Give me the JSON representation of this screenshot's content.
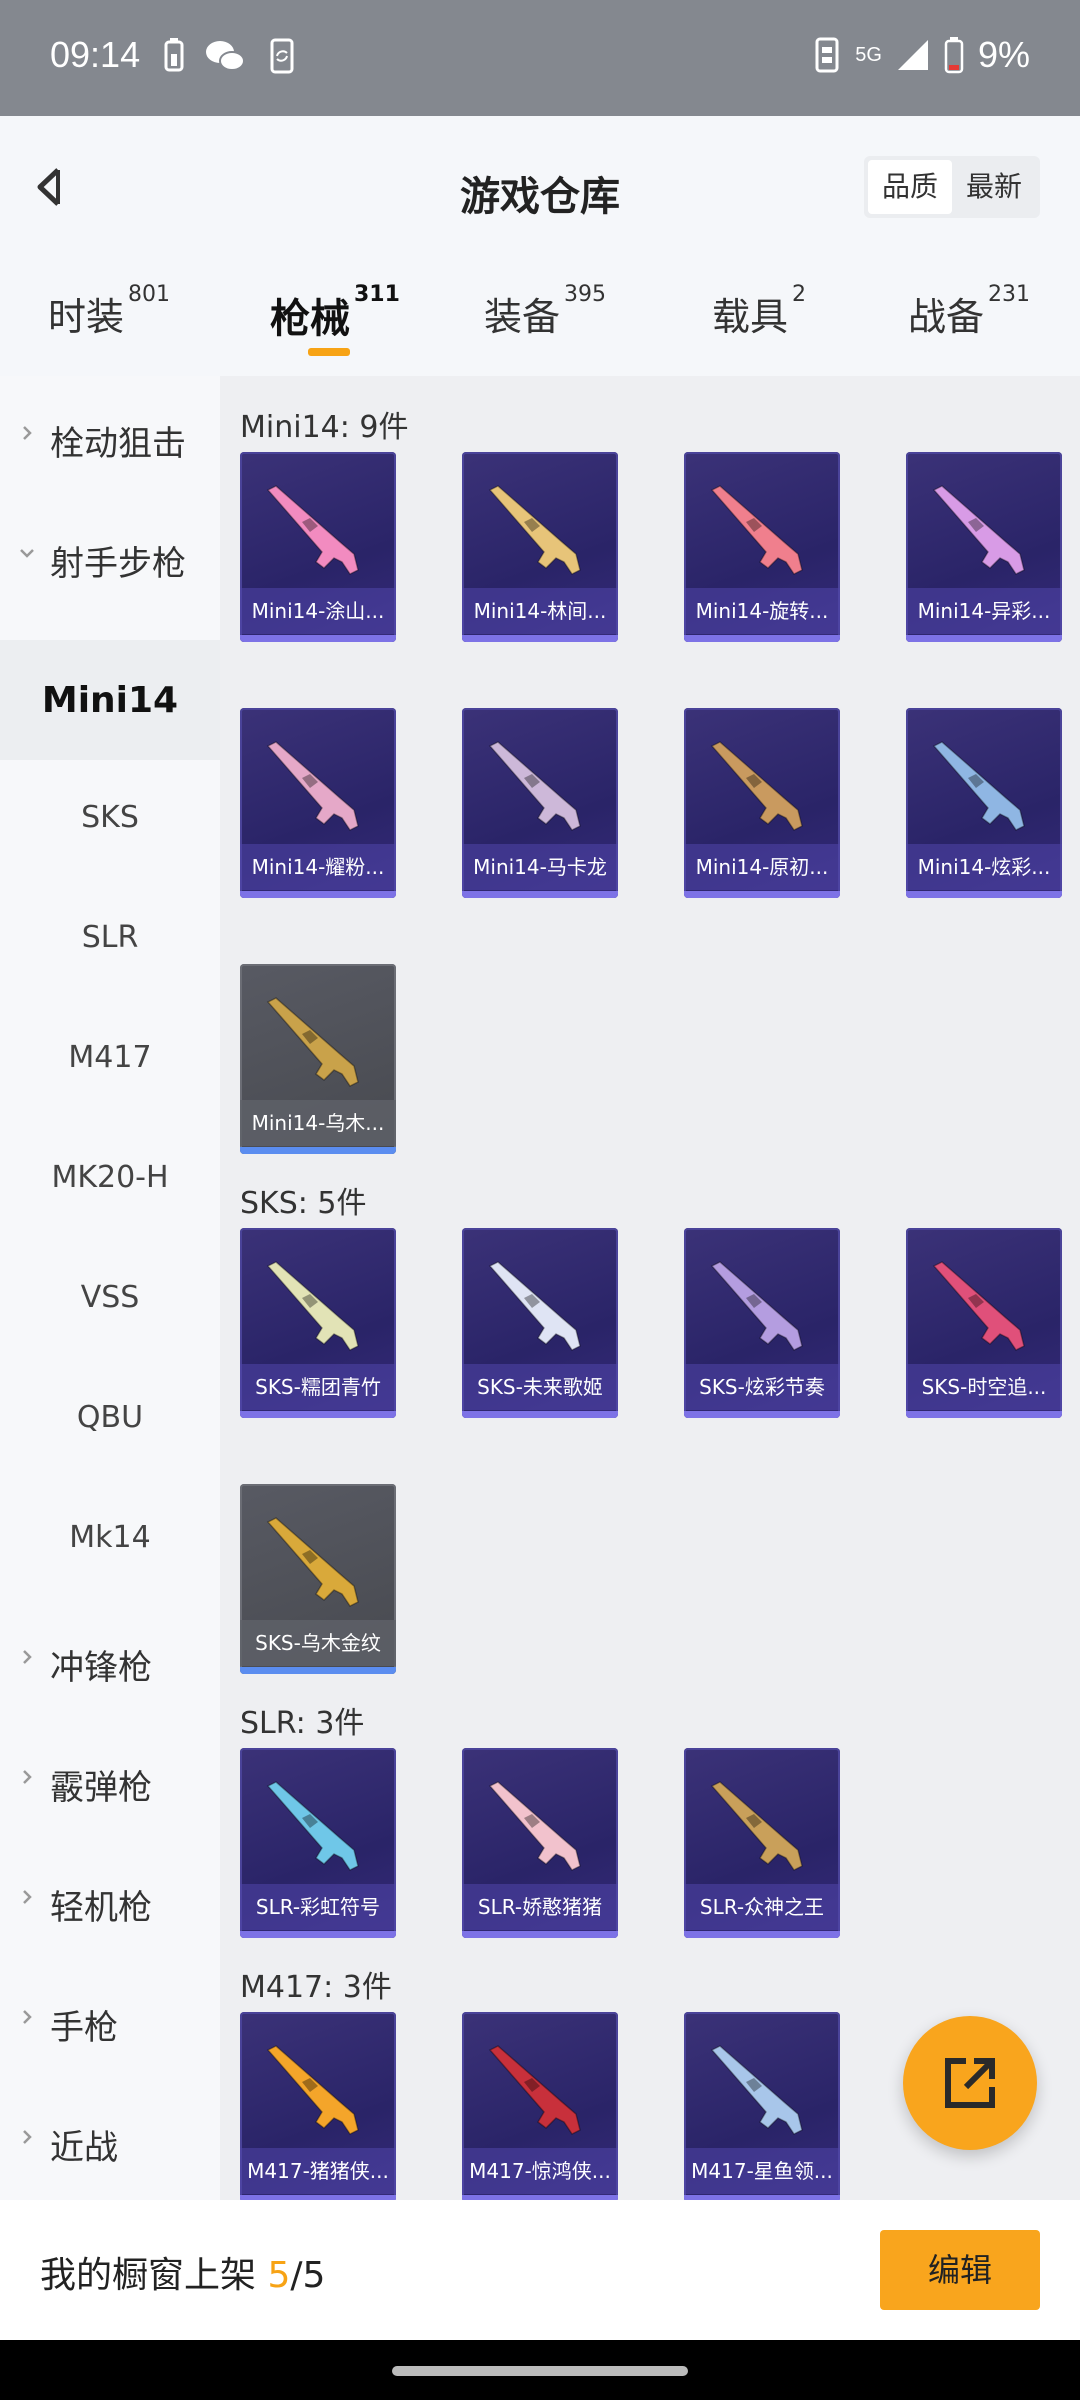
{
  "status_bar": {
    "time": "09:14",
    "network": "5G",
    "battery": "9%"
  },
  "header": {
    "title": "游戏仓库",
    "sort_options": [
      {
        "label": "品质",
        "active": true
      },
      {
        "label": "最新",
        "active": false
      }
    ]
  },
  "tabs": [
    {
      "label": "时装",
      "count": "801",
      "active": false
    },
    {
      "label": "枪械",
      "count": "311",
      "active": true
    },
    {
      "label": "装备",
      "count": "395",
      "active": false
    },
    {
      "label": "载具",
      "count": "2",
      "active": false
    },
    {
      "label": "战备",
      "count": "231",
      "active": false
    }
  ],
  "sidebar": {
    "items": [
      {
        "label": "栓动狙击",
        "type": "category",
        "expanded": false
      },
      {
        "label": "射手步枪",
        "type": "category",
        "expanded": true
      },
      {
        "label": "Mini14",
        "type": "sub",
        "selected": true
      },
      {
        "label": "SKS",
        "type": "sub"
      },
      {
        "label": "SLR",
        "type": "sub"
      },
      {
        "label": "M417",
        "type": "sub"
      },
      {
        "label": "MK20-H",
        "type": "sub"
      },
      {
        "label": "VSS",
        "type": "sub"
      },
      {
        "label": "QBU",
        "type": "sub"
      },
      {
        "label": "Mk14",
        "type": "sub"
      },
      {
        "label": "冲锋枪",
        "type": "category",
        "expanded": false
      },
      {
        "label": "霰弹枪",
        "type": "category",
        "expanded": false
      },
      {
        "label": "轻机枪",
        "type": "category",
        "expanded": false
      },
      {
        "label": "手枪",
        "type": "category",
        "expanded": false
      },
      {
        "label": "近战",
        "type": "category",
        "expanded": false
      }
    ]
  },
  "sections": [
    {
      "title": "Mini14: 9件",
      "items": [
        {
          "name": "Mini14-涂山...",
          "rarity": "purple",
          "color": "#f28bc0"
        },
        {
          "name": "Mini14-林间...",
          "rarity": "purple",
          "color": "#e7c479"
        },
        {
          "name": "Mini14-旋转...",
          "rarity": "purple",
          "color": "#f07f8d"
        },
        {
          "name": "Mini14-异彩...",
          "rarity": "purple",
          "color": "#d89be6"
        },
        {
          "name": "Mini14-耀粉...",
          "rarity": "purple",
          "color": "#e5a8c8"
        },
        {
          "name": "Mini14-马卡龙",
          "rarity": "purple",
          "color": "#cdb8d9"
        },
        {
          "name": "Mini14-原初...",
          "rarity": "purple",
          "color": "#c99a5f"
        },
        {
          "name": "Mini14-炫彩...",
          "rarity": "purple",
          "color": "#8fb6e3"
        },
        {
          "name": "Mini14-乌木...",
          "rarity": "grey",
          "color": "#c9a24a"
        }
      ]
    },
    {
      "title": "SKS: 5件",
      "items": [
        {
          "name": "SKS-糯团青竹",
          "rarity": "purple",
          "color": "#e2e3b6"
        },
        {
          "name": "SKS-未来歌姬",
          "rarity": "purple",
          "color": "#dfe4f4"
        },
        {
          "name": "SKS-炫彩节奏",
          "rarity": "purple",
          "color": "#b49de0"
        },
        {
          "name": "SKS-时空追...",
          "rarity": "purple",
          "color": "#e0507a"
        },
        {
          "name": "SKS-乌木金纹",
          "rarity": "grey",
          "color": "#d9a93a"
        }
      ]
    },
    {
      "title": "SLR: 3件",
      "items": [
        {
          "name": "SLR-彩虹符号",
          "rarity": "purple",
          "color": "#6fc7e8"
        },
        {
          "name": "SLR-娇憨猪猪",
          "rarity": "purple",
          "color": "#f2c2cd"
        },
        {
          "name": "SLR-众神之王",
          "rarity": "purple",
          "color": "#c9a05a"
        }
      ]
    },
    {
      "title": "M417: 3件",
      "items": [
        {
          "name": "M417-猪猪侠...",
          "rarity": "purple",
          "color": "#f4a52a"
        },
        {
          "name": "M417-惊鸿侠...",
          "rarity": "purple",
          "color": "#c8303b"
        },
        {
          "name": "M417-星鱼领...",
          "rarity": "purple",
          "color": "#a8c6ea"
        }
      ]
    }
  ],
  "bottom_bar": {
    "text": "我的橱窗上架 ",
    "current": "5",
    "separator": "/",
    "total": "5",
    "edit_label": "编辑"
  },
  "colors": {
    "accent": "#f9a51d",
    "card_purple": "#2f2870",
    "card_grey": "#4d4f56"
  }
}
